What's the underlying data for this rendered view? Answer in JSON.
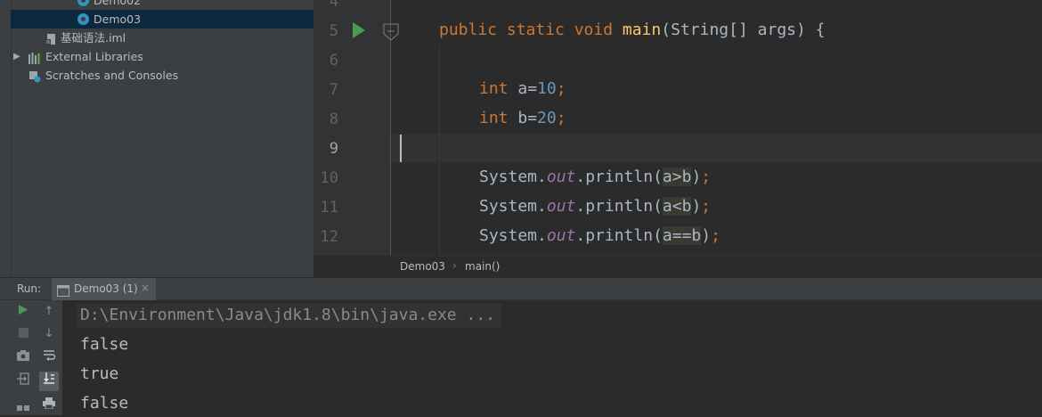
{
  "tree": {
    "items": [
      {
        "label": "Demo02"
      },
      {
        "label": "Demo03"
      },
      {
        "label": "基础语法.iml"
      },
      {
        "label": "External Libraries"
      },
      {
        "label": "Scratches and Consoles"
      }
    ]
  },
  "editor": {
    "line_numbers": [
      "4",
      "5",
      "6",
      "7",
      "8",
      "9",
      "10",
      "11",
      "12"
    ],
    "code": {
      "l5": {
        "mods": "public static void",
        "name": "main",
        "params": "(String[] args) {"
      },
      "l7": {
        "type": "int",
        "text": " a=",
        "num": "10",
        "end": ";"
      },
      "l8": {
        "type": "int",
        "text": " b=",
        "num": "20",
        "end": ";"
      },
      "l10": {
        "obj": "System.",
        "field": "out",
        "call": ".println(",
        "arg": "a>b",
        "close": ")",
        "end": ";"
      },
      "l11": {
        "obj": "System.",
        "field": "out",
        "call": ".println(",
        "arg": "a<b",
        "close": ")",
        "end": ";"
      },
      "l12": {
        "obj": "System.",
        "field": "out",
        "call": ".println(",
        "arg": "a==b",
        "close": ")",
        "end": ";"
      }
    }
  },
  "breadcrumb": {
    "file": "Demo03",
    "sep": "›",
    "method": "main()"
  },
  "run": {
    "label": "Run:",
    "tab": "Demo03 (1)",
    "console": [
      "D:\\Environment\\Java\\jdk1.8\\bin\\java.exe ...",
      "false",
      "true",
      "false"
    ]
  },
  "colors": {
    "keyword": "#cc7832",
    "function": "#ffc66d",
    "number": "#6897bb",
    "field": "#9876aa",
    "run_green": "#499c54"
  }
}
